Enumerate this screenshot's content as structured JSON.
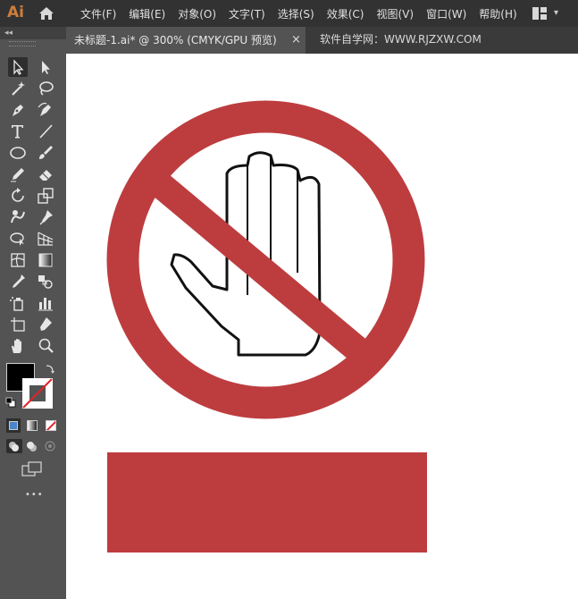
{
  "app": {
    "logo": "Ai"
  },
  "menu": [
    "文件(F)",
    "编辑(E)",
    "对象(O)",
    "文字(T)",
    "选择(S)",
    "效果(C)",
    "视图(V)",
    "窗口(W)",
    "帮助(H)"
  ],
  "tab": {
    "title": "未标题-1.ai* @ 300% (CMYK/GPU 预览)",
    "close": "×",
    "watermark": "软件自学网：WWW.RJZXW.COM"
  },
  "toolbar": {
    "collapse": "◂◂",
    "more": "•••",
    "tools": [
      "selection-tool",
      "direct-selection-tool",
      "magic-wand-tool",
      "lasso-tool",
      "pen-tool",
      "curvature-tool",
      "type-tool",
      "line-tool",
      "ellipse-tool",
      "paintbrush-tool",
      "pencil-tool",
      "eraser-tool",
      "rotate-tool",
      "scale-tool",
      "warp-tool",
      "puppet-warp-tool",
      "shape-builder-tool",
      "perspective-grid-tool",
      "mesh-tool",
      "gradient-tool",
      "eyedropper-tool",
      "blend-tool",
      "symbol-sprayer-tool",
      "column-graph-tool",
      "artboard-tool",
      "slice-tool",
      "hand-tool",
      "zoom-tool"
    ]
  },
  "colors": {
    "accent_red": "#bd3d3f",
    "fill": "#000000",
    "stroke": "#ffffff"
  }
}
